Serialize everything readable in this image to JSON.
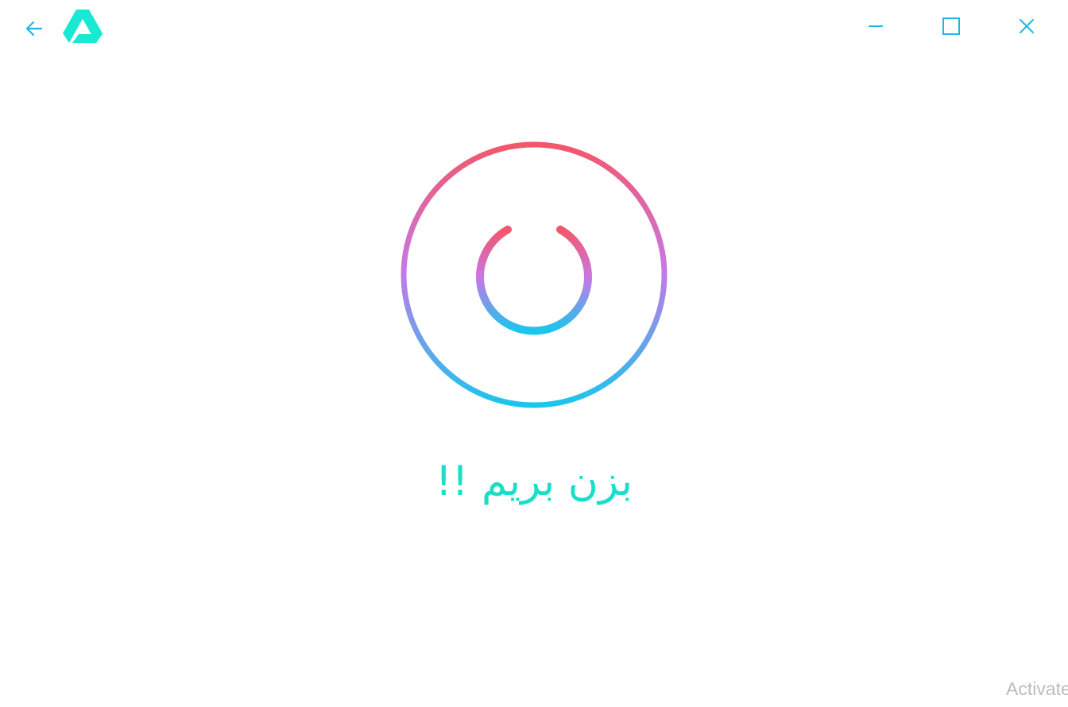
{
  "titlebar": {
    "back_icon": "arrow-left-icon",
    "logo_icon": "triangle-drive-logo-icon",
    "minimize_icon": "minimize-icon",
    "maximize_icon": "maximize-icon",
    "close_icon": "close-icon"
  },
  "main": {
    "power_icon": "power-icon",
    "start_label": "بزن بریم !!"
  },
  "watermark": {
    "text": "Activate"
  },
  "colors": {
    "accent_cyan": "#19dfc9",
    "titlebar_icon": "#1fb6e6",
    "gradient_top": "#f2576a",
    "gradient_mid": "#c778e6",
    "gradient_bottom": "#1ac6ec",
    "watermark": "#b9bcc2"
  }
}
